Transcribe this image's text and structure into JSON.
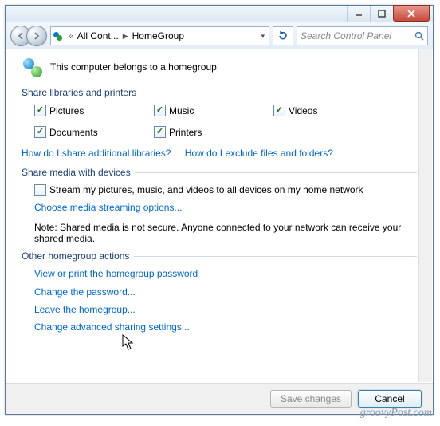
{
  "titlebar": {
    "minimize": "–",
    "maximize": "□",
    "close": "×"
  },
  "navbar": {
    "back": "◄",
    "forward": "►",
    "crumb_prefix": "«",
    "crumb1": "All Cont...",
    "crumb2": "HomeGroup",
    "refresh_icon": "↻"
  },
  "search": {
    "placeholder": "Search Control Panel"
  },
  "header": {
    "text": "This computer belongs to a homegroup."
  },
  "section1": {
    "title": "Share libraries and printers",
    "items": [
      {
        "label": "Pictures",
        "checked": true
      },
      {
        "label": "Music",
        "checked": true
      },
      {
        "label": "Videos",
        "checked": true
      },
      {
        "label": "Documents",
        "checked": true
      },
      {
        "label": "Printers",
        "checked": true
      }
    ]
  },
  "help_links": {
    "share_more": "How do I share additional libraries?",
    "exclude": "How do I exclude files and folders?"
  },
  "section2": {
    "title": "Share media with devices",
    "stream_checkbox": {
      "label": "Stream my pictures, music, and videos to all devices on my home network",
      "checked": false
    },
    "streaming_link": "Choose media streaming options...",
    "note": "Note: Shared media is not secure. Anyone connected to your network can receive your shared media."
  },
  "section3": {
    "title": "Other homegroup actions",
    "links": [
      "View or print the homegroup password",
      "Change the password...",
      "Leave the homegroup...",
      "Change advanced sharing settings..."
    ]
  },
  "footer": {
    "save": "Save changes",
    "cancel": "Cancel"
  },
  "watermark": "groovyPost.com"
}
